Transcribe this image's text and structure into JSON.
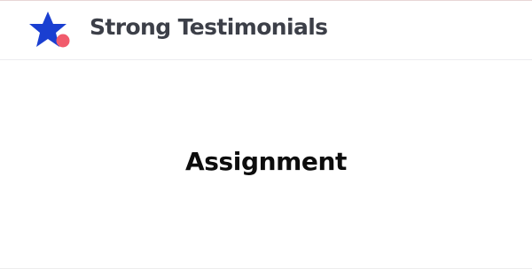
{
  "header": {
    "brand_name": "Strong Testimonials",
    "logo_icon": "star-logo-icon",
    "colors": {
      "star": "#1a3fd1",
      "dot": "#f15b6c",
      "brand_text": "#3c3f48"
    }
  },
  "main": {
    "title": "Assignment"
  }
}
